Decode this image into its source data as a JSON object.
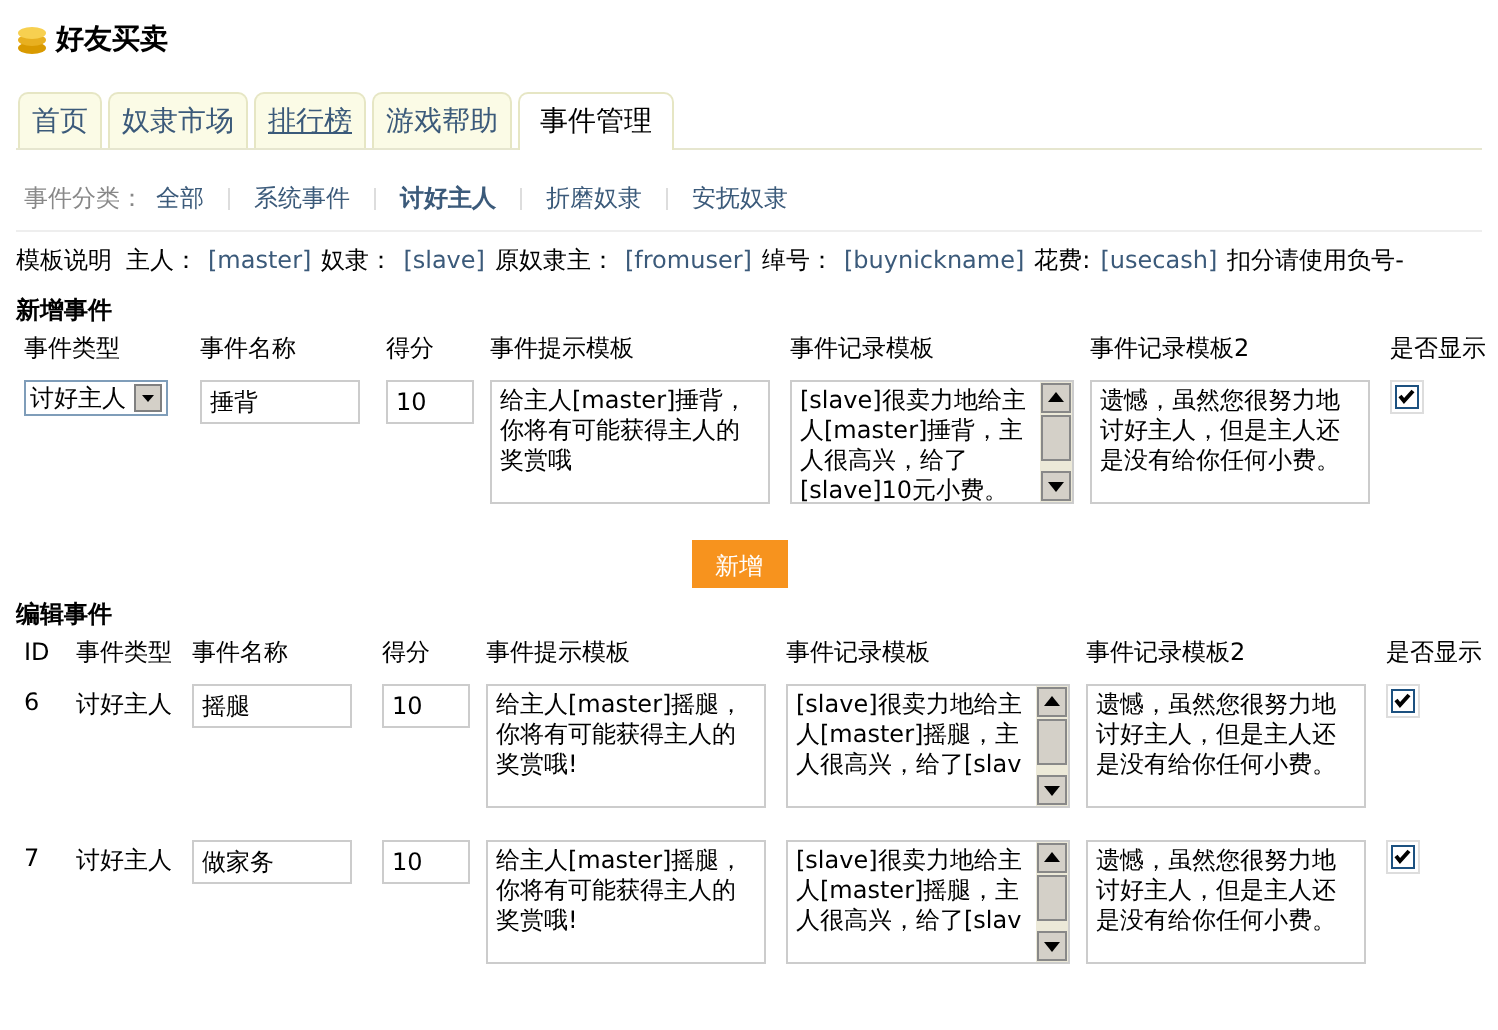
{
  "app": {
    "title": "好友买卖"
  },
  "tabs": [
    {
      "label": "首页",
      "selected": false,
      "hovered": false
    },
    {
      "label": "奴隶市场",
      "selected": false,
      "hovered": false
    },
    {
      "label": "排行榜",
      "selected": false,
      "hovered": true
    },
    {
      "label": "游戏帮助",
      "selected": false,
      "hovered": false
    },
    {
      "label": "事件管理",
      "selected": true,
      "hovered": false
    }
  ],
  "filter": {
    "label": "事件分类：",
    "items": [
      {
        "label": "全部",
        "selected": false
      },
      {
        "label": "系统事件",
        "selected": false
      },
      {
        "label": "讨好主人",
        "selected": true
      },
      {
        "label": "折磨奴隶",
        "selected": false
      },
      {
        "label": "安抚奴隶",
        "selected": false
      }
    ]
  },
  "template_help": {
    "label": "模板说明",
    "parts": [
      {
        "kind": "text",
        "text": "主人："
      },
      {
        "kind": "var",
        "text": "[master]"
      },
      {
        "kind": "text",
        "text": "奴隶："
      },
      {
        "kind": "var",
        "text": "[slave]"
      },
      {
        "kind": "text",
        "text": "原奴隶主："
      },
      {
        "kind": "var",
        "text": "[fromuser]"
      },
      {
        "kind": "text",
        "text": "绰号："
      },
      {
        "kind": "var",
        "text": "[buynickname]"
      },
      {
        "kind": "text",
        "text": "花费:"
      },
      {
        "kind": "var",
        "text": "[usecash]"
      },
      {
        "kind": "text",
        "text": "扣分请使用负号-"
      }
    ]
  },
  "new_event": {
    "title": "新增事件",
    "columns": [
      "事件类型",
      "事件名称",
      "得分",
      "事件提示模板",
      "事件记录模板",
      "事件记录模板2",
      "是否显示"
    ],
    "row": {
      "type": "讨好主人",
      "name": "捶背",
      "score": "10",
      "hint": "给主人[master]捶背，你将有可能获得主人的奖赏哦",
      "record": "[slave]很卖力地给主人[master]捶背，主人很高兴，给了[slave]10元小费。",
      "record2": "遗憾，虽然您很努力地讨好主人，但是主人还是没有给你任何小费。",
      "show": true
    }
  },
  "add_button": {
    "label": "新增"
  },
  "edit_events": {
    "title": "编辑事件",
    "columns": [
      "ID",
      "事件类型",
      "事件名称",
      "得分",
      "事件提示模板",
      "事件记录模板",
      "事件记录模板2",
      "是否显示"
    ],
    "rows": [
      {
        "id": "6",
        "type": "讨好主人",
        "name": "摇腿",
        "score": "10",
        "hint": "给主人[master]摇腿，你将有可能获得主人的奖赏哦!",
        "record": "[slave]很卖力地给主人[master]摇腿，主人很高兴，给了[slav",
        "record2": "遗憾，虽然您很努力地讨好主人，但是主人还是没有给你任何小费。",
        "show": true
      },
      {
        "id": "7",
        "type": "讨好主人",
        "name": "做家务",
        "score": "10",
        "hint": "给主人[master]摇腿，你将有可能获得主人的奖赏哦!",
        "record": "[slave]很卖力地给主人[master]摇腿，主人很高兴，给了[slav",
        "record2": "遗憾，虽然您很努力地讨好主人，但是主人还是没有给你任何小费。",
        "show": true
      }
    ]
  }
}
